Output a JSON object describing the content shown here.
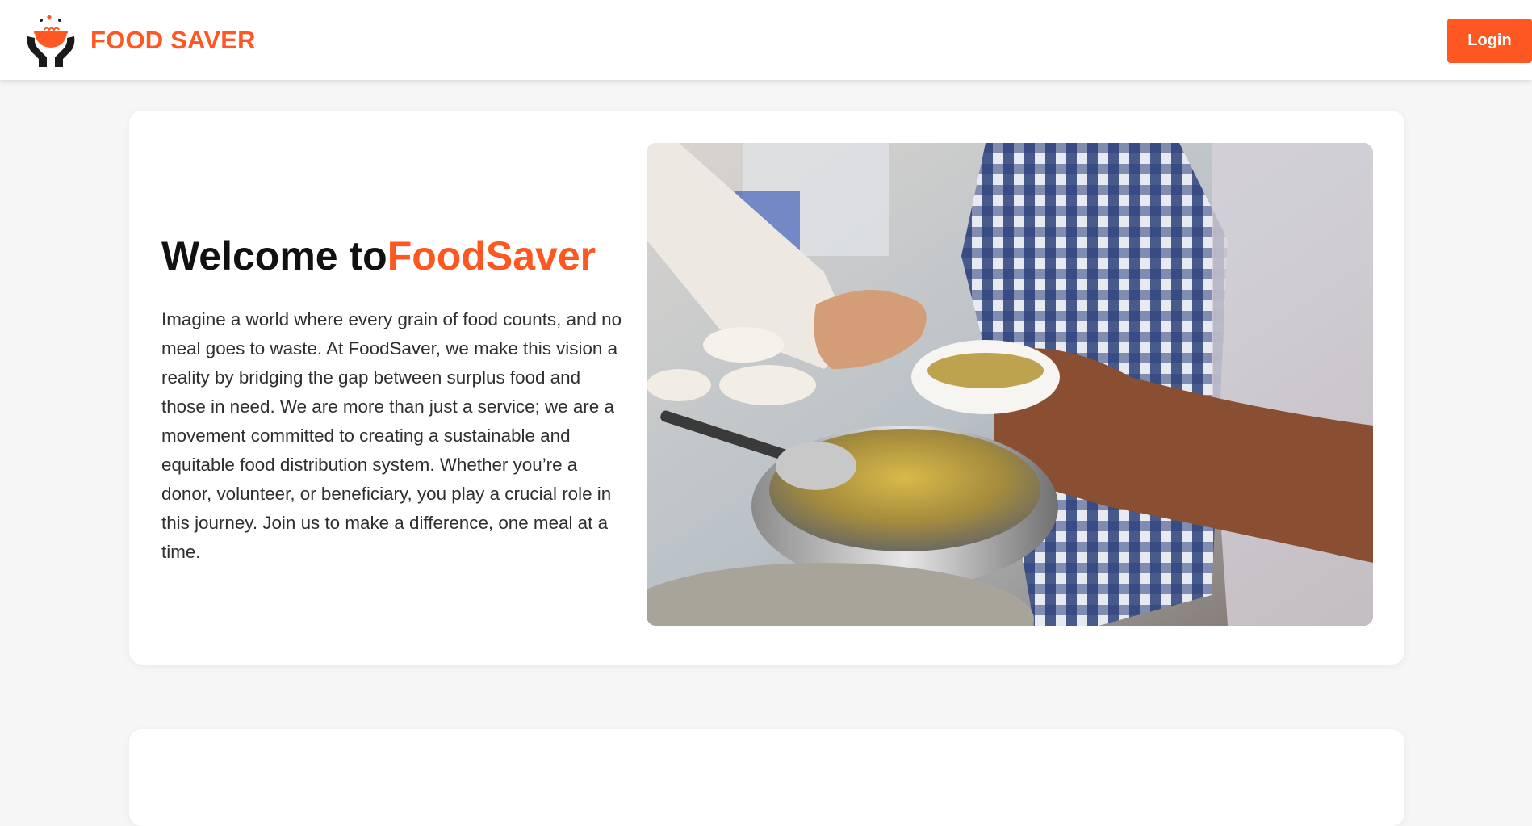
{
  "header": {
    "brand_name": "FOOD SAVER",
    "logo_icon": "hands-holding-bowl-icon",
    "login_label": "Login"
  },
  "hero": {
    "title_prefix": "Welcome to",
    "title_accent": "FoodSaver",
    "description": "Imagine a world where every grain of food counts, and no meal goes to waste. At FoodSaver, we make this vision a reality by bridging the gap between surplus food and those in need. We are more than just a service; we are a movement committed to creating a sustainable and equitable food distribution system. Whether you’re a donor, volunteer, or beneficiary, you play a crucial role in this journey. Join us to make a difference, one meal at a time."
  },
  "colors": {
    "accent": "#ff5722",
    "text": "#2e2e2e",
    "background": "#f6f6f6",
    "card": "#ffffff"
  }
}
